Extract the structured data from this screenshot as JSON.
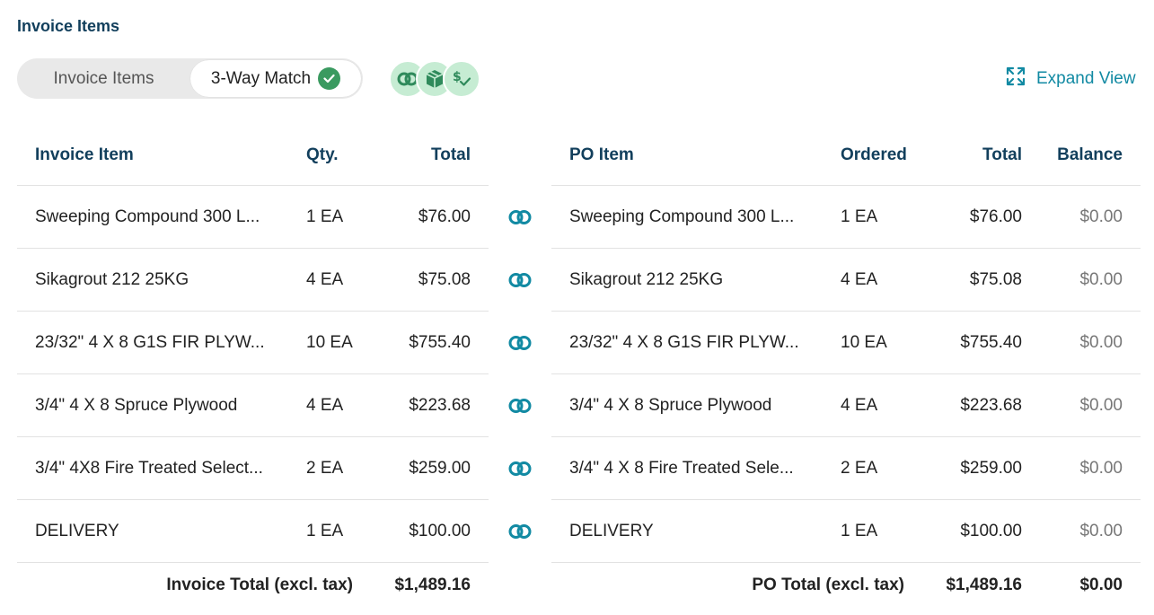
{
  "section_title": "Invoice Items",
  "toggle": {
    "invoice_items_label": "Invoice Items",
    "three_way_label": "3-Way Match"
  },
  "expand_label": "Expand View",
  "invoice_table": {
    "headers": {
      "item": "Invoice Item",
      "qty": "Qty.",
      "total": "Total"
    },
    "rows": [
      {
        "item": "Sweeping Compound 300 L...",
        "qty": "1 EA",
        "total": "$76.00"
      },
      {
        "item": "Sikagrout 212 25KG",
        "qty": "4 EA",
        "total": "$75.08"
      },
      {
        "item": "23/32\" 4 X 8 G1S FIR PLYW...",
        "qty": "10 EA",
        "total": "$755.40"
      },
      {
        "item": "3/4\" 4 X 8 Spruce Plywood",
        "qty": "4 EA",
        "total": "$223.68"
      },
      {
        "item": "3/4\" 4X8 Fire Treated Select...",
        "qty": "2 EA",
        "total": "$259.00"
      },
      {
        "item": "DELIVERY",
        "qty": "1 EA",
        "total": "$100.00"
      }
    ],
    "footer": {
      "label": "Invoice Total (excl. tax)",
      "total": "$1,489.16"
    }
  },
  "po_table": {
    "headers": {
      "item": "PO Item",
      "ordered": "Ordered",
      "total": "Total",
      "balance": "Balance"
    },
    "rows": [
      {
        "item": "Sweeping Compound 300 L...",
        "ordered": "1 EA",
        "total": "$76.00",
        "balance": "$0.00"
      },
      {
        "item": "Sikagrout 212 25KG",
        "ordered": "4 EA",
        "total": "$75.08",
        "balance": "$0.00"
      },
      {
        "item": "23/32\" 4 X 8 G1S FIR PLYW...",
        "ordered": "10 EA",
        "total": "$755.40",
        "balance": "$0.00"
      },
      {
        "item": "3/4\" 4 X 8 Spruce Plywood",
        "ordered": "4 EA",
        "total": "$223.68",
        "balance": "$0.00"
      },
      {
        "item": "3/4\" 4 X 8 Fire Treated Sele...",
        "ordered": "2 EA",
        "total": "$259.00",
        "balance": "$0.00"
      },
      {
        "item": "DELIVERY",
        "ordered": "1 EA",
        "total": "$100.00",
        "balance": "$0.00"
      }
    ],
    "footer": {
      "label": "PO Total (excl. tax)",
      "total": "$1,489.16",
      "balance": "$0.00"
    }
  },
  "icons": {
    "match_status": [
      "linked-rings-icon",
      "package-icon",
      "dollar-check-icon"
    ],
    "row_link": "linked-rings-icon",
    "expand": "expand-arrows-icon",
    "check": "check-icon"
  },
  "colors": {
    "heading": "#123f5c",
    "accent": "#128aa3",
    "success": "#3a9a60",
    "match_bg": "#c6ecd3"
  }
}
